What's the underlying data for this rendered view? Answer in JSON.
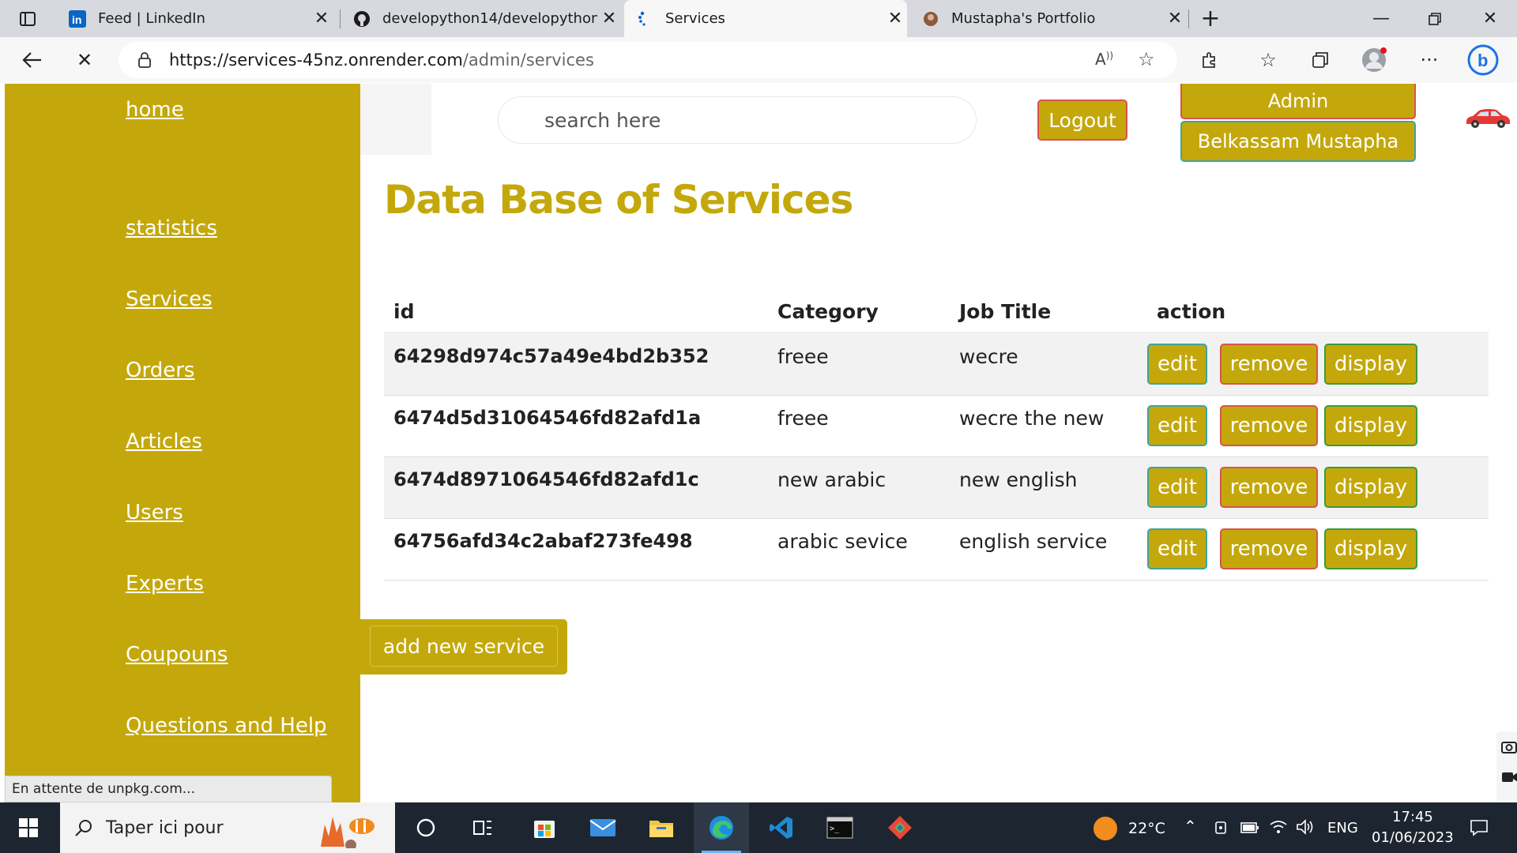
{
  "browser": {
    "tabs": [
      {
        "title": "Feed | LinkedIn",
        "icon": "linkedin-icon"
      },
      {
        "title": "developython14/developython14",
        "icon": "github-icon"
      },
      {
        "title": "Services",
        "icon": "spinner-icon"
      },
      {
        "title": "Mustapha's Portfolio",
        "icon": "portfolio-icon"
      }
    ],
    "active_tab": 2,
    "url_host": "https://services-45nz.onrender.com",
    "url_path": "/admin/services"
  },
  "sidebar": {
    "items": [
      {
        "label": "home"
      },
      {
        "label": "statistics"
      },
      {
        "label": "Services"
      },
      {
        "label": "Orders"
      },
      {
        "label": "Articles"
      },
      {
        "label": "Users"
      },
      {
        "label": "Experts"
      },
      {
        "label": "Coupouns"
      },
      {
        "label": "Questions and Help"
      }
    ]
  },
  "header": {
    "search_placeholder": "search here",
    "logout_label": "Logout",
    "role_label": "Admin",
    "user_name": "Belkassam Mustapha"
  },
  "main": {
    "title": "Data Base of Services",
    "columns": [
      "id",
      "Category",
      "Job Title",
      "action"
    ],
    "rows": [
      {
        "id": "64298d974c57a49e4bd2b352",
        "category": "freee",
        "job_title": "wecre"
      },
      {
        "id": "6474d5d31064546fd82afd1a",
        "category": "freee",
        "job_title": "wecre the new"
      },
      {
        "id": "6474d8971064546fd82afd1c",
        "category": "new arabic",
        "job_title": "new english"
      },
      {
        "id": "64756afd34c2abaf273fe498",
        "category": "arabic sevice",
        "job_title": "english service"
      }
    ],
    "row_actions": {
      "edit": "edit",
      "remove": "remove",
      "display": "display"
    },
    "add_button_label": "add new service"
  },
  "status_text": "En attente de unpkg.com...",
  "taskbar": {
    "search_text": "Taper ici pour",
    "weather": "22°C",
    "language": "ENG",
    "time": "17:45",
    "date": "01/06/2023"
  },
  "colors": {
    "accent": "#c4a80b",
    "danger_border": "#d9534f",
    "info_border": "#3aa5a0",
    "success_border": "#3a9c3a"
  }
}
